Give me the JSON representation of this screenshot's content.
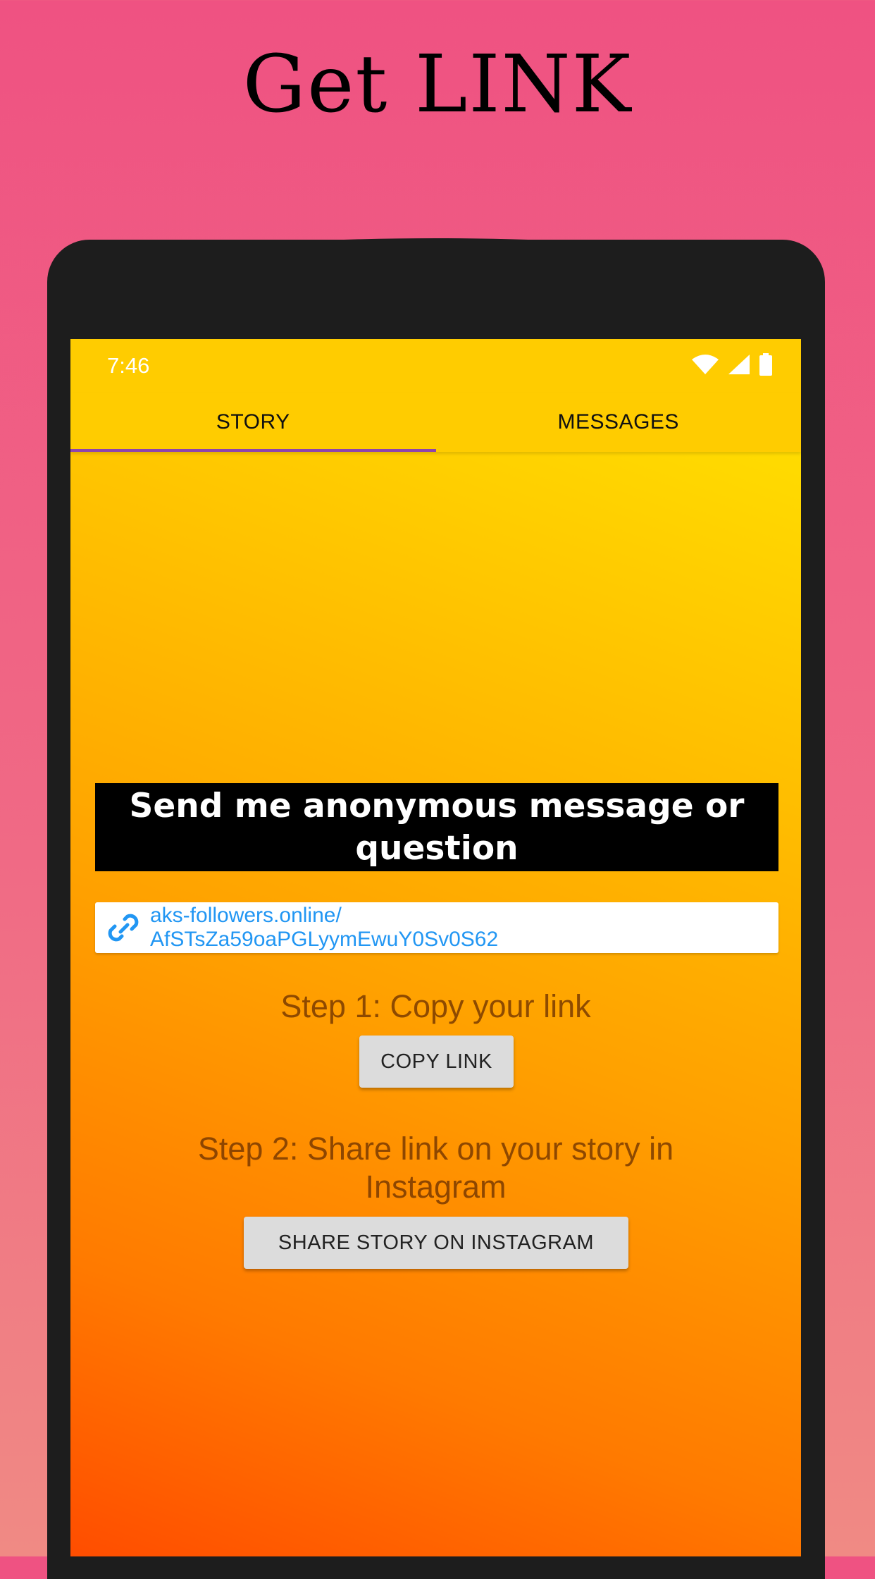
{
  "promo": {
    "title": "Get LINK"
  },
  "status_bar": {
    "time": "7:46",
    "icons": [
      "wifi-icon",
      "signal-icon",
      "battery-icon"
    ]
  },
  "tabs": [
    {
      "label": "STORY",
      "active": true
    },
    {
      "label": "MESSAGES",
      "active": false
    }
  ],
  "main": {
    "headline": "Send  me  anonymous message or question",
    "link_line1": "aks-followers.online/",
    "link_line2": "AfSTsZa59oaPGLyymEwuY0Sv0S62",
    "step1": "Step 1: Copy your link",
    "copy_button": "COPY LINK",
    "step2": "Step 2: Share link on your story in Instagram",
    "share_button": "SHARE STORY ON INSTAGRAM"
  },
  "colors": {
    "page_background": "#ef5282",
    "tab_bar": "#ffcc00",
    "tab_indicator": "#8e44ad",
    "link_text": "#2196f3",
    "headline_background": "#000000"
  }
}
